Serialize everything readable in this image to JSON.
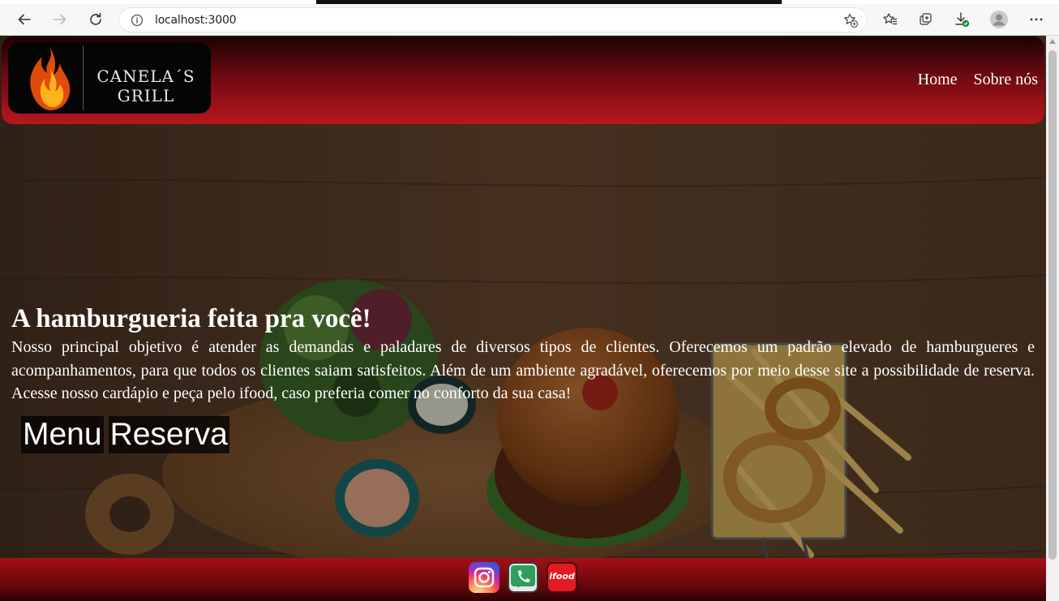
{
  "browser": {
    "url": "localhost:3000",
    "icons": [
      "back-icon",
      "forward-icon",
      "reload-icon",
      "info-icon",
      "favorite-add-icon",
      "favorites-icon",
      "collections-icon",
      "downloads-icon",
      "profile-icon",
      "more-icon"
    ]
  },
  "site": {
    "logo": {
      "line1": "CANELA´S",
      "line2": "GRILL"
    },
    "nav": [
      "Home",
      "Sobre nós"
    ]
  },
  "hero": {
    "title": "A hamburgueria feita pra você!",
    "text": "Nosso principal objetivo é atender as demandas e paladares de diversos tipos de clientes. Oferecemos um padrão elevado de hamburgueres e acompanhamentos, para que todos os clientes saiam satisfeitos. Além de um ambiente agradável, oferecemos por meio desse site a possibilidade de reserva. Acesse nosso cardápio e peça pelo ifood, caso preferia comer no conforto da sua casa!",
    "buttons": [
      "Menu",
      "Reserva"
    ]
  },
  "footer": {
    "social": [
      "instagram-icon",
      "whatsapp-phone-icon",
      "ifood-icon"
    ],
    "ifood_label": "ifood"
  },
  "colors": {
    "header_dark": "#1a0204",
    "header_red": "#b8161e",
    "footer_red": "#a31016"
  }
}
